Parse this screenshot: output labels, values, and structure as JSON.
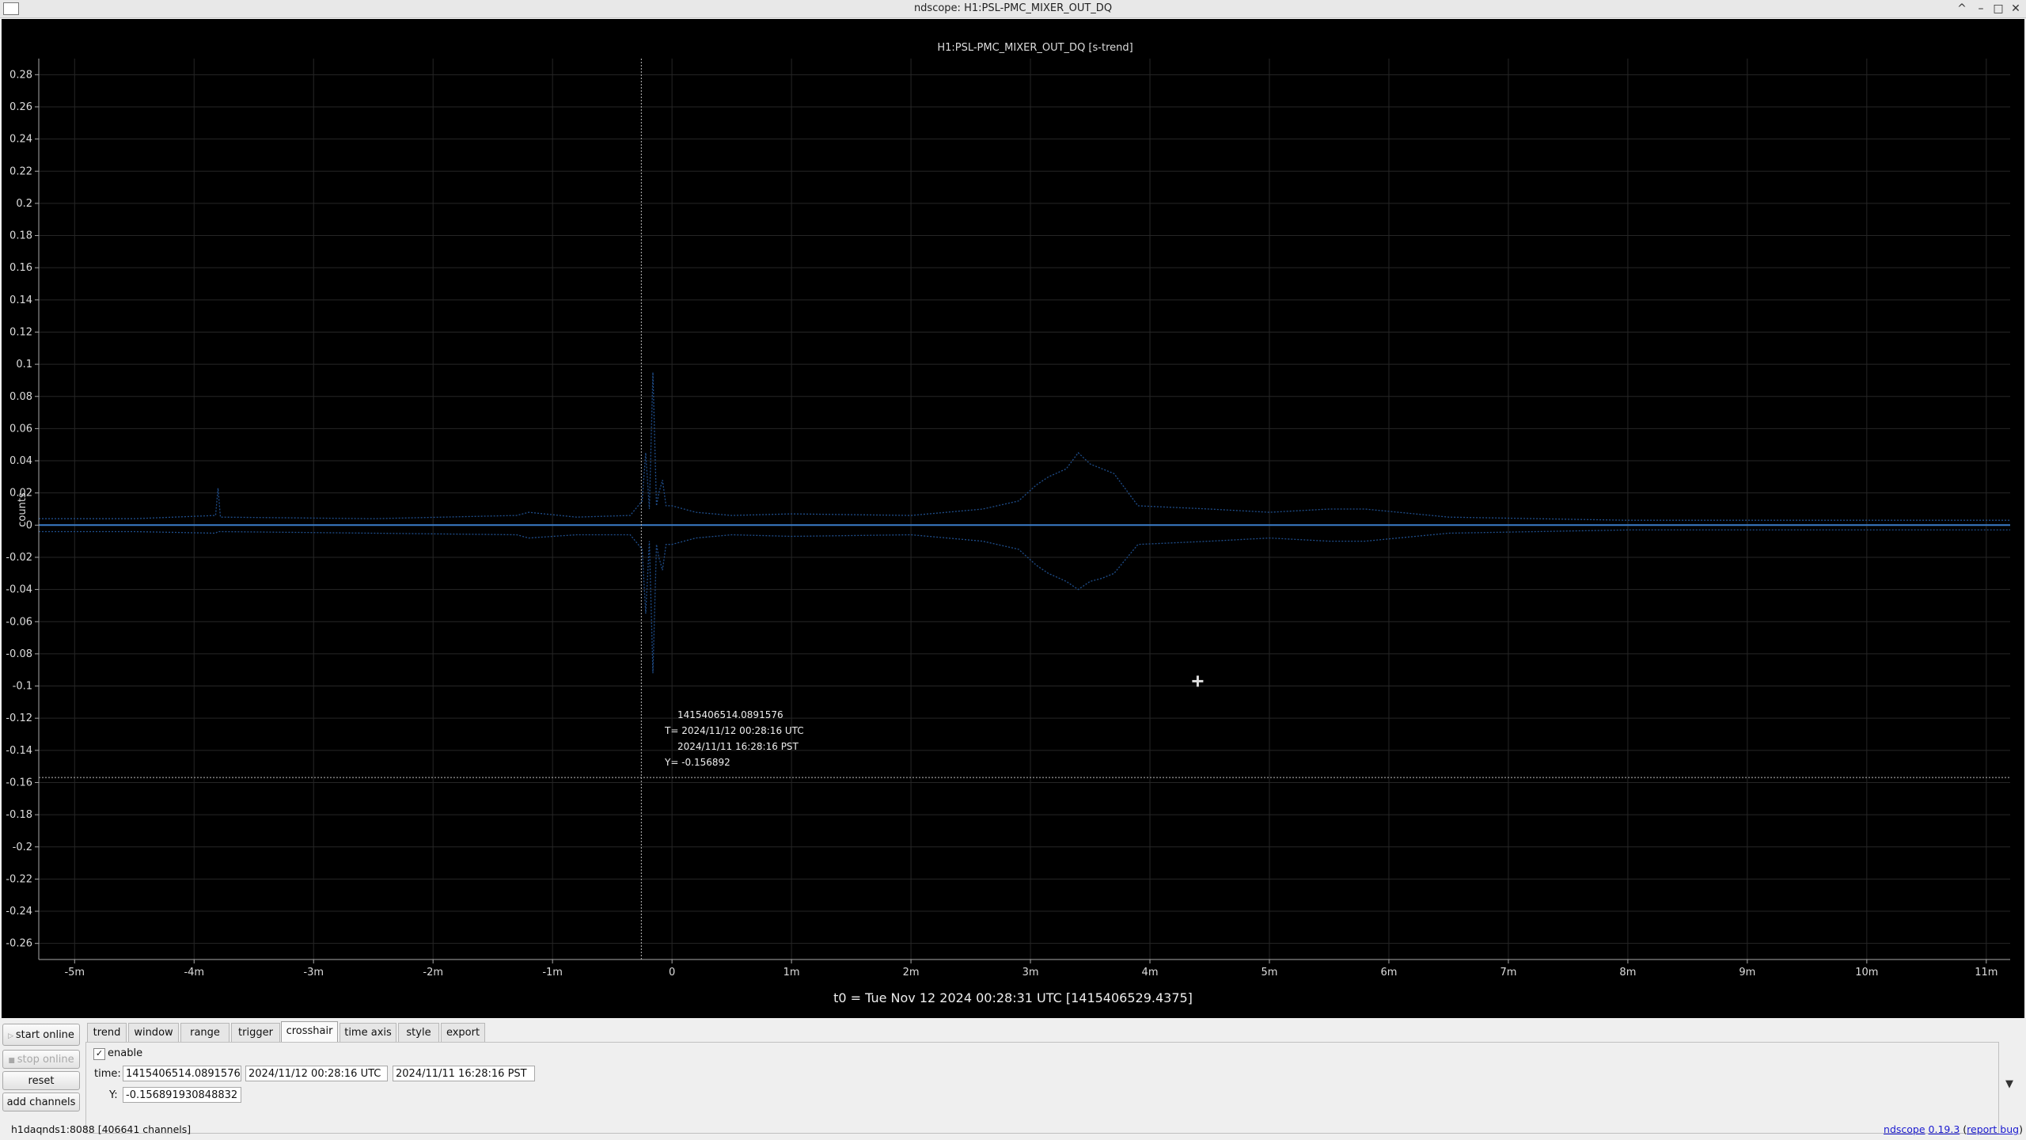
{
  "window": {
    "title": "ndscope: H1:PSL-PMC_MIXER_OUT_DQ",
    "controls": [
      "^",
      "–",
      "□",
      "✕"
    ]
  },
  "plot": {
    "title": "H1:PSL-PMC_MIXER_OUT_DQ [s-trend]",
    "t0_label": "t0 = Tue Nov 12 2024 00:28:31 UTC [1415406529.4375]",
    "crosshair": {
      "gps": "1415406514.0891576",
      "utc": "T= 2024/11/12 00:28:16 UTC",
      "pst": "2024/11/11 16:28:16 PST",
      "y": "Y= -0.156892",
      "x_value": -0.2569,
      "y_value": -0.156892
    },
    "cursor_marker": {
      "x_value": 4.4,
      "y_value": -0.097
    }
  },
  "chart_data": {
    "type": "line",
    "title": "H1:PSL-PMC_MIXER_OUT_DQ [s-trend]",
    "xlabel": "",
    "ylabel": "counts",
    "xlim": [
      -5.3,
      11.2
    ],
    "ylim": [
      -0.27,
      0.29
    ],
    "grid": true,
    "x_ticks": [
      {
        "v": -5,
        "label": "-5m"
      },
      {
        "v": -4,
        "label": "-4m"
      },
      {
        "v": -3,
        "label": "-3m"
      },
      {
        "v": -2,
        "label": "-2m"
      },
      {
        "v": -1,
        "label": "-1m"
      },
      {
        "v": 0,
        "label": "0"
      },
      {
        "v": 1,
        "label": "1m"
      },
      {
        "v": 2,
        "label": "2m"
      },
      {
        "v": 3,
        "label": "3m"
      },
      {
        "v": 4,
        "label": "4m"
      },
      {
        "v": 5,
        "label": "5m"
      },
      {
        "v": 6,
        "label": "6m"
      },
      {
        "v": 7,
        "label": "7m"
      },
      {
        "v": 8,
        "label": "8m"
      },
      {
        "v": 9,
        "label": "9m"
      },
      {
        "v": 10,
        "label": "10m"
      },
      {
        "v": 11,
        "label": "11m"
      }
    ],
    "y_ticks": [
      {
        "v": 0.28,
        "label": "0.28"
      },
      {
        "v": 0.26,
        "label": "0.26"
      },
      {
        "v": 0.24,
        "label": "0.24"
      },
      {
        "v": 0.22,
        "label": "0.22"
      },
      {
        "v": 0.2,
        "label": "0.2"
      },
      {
        "v": 0.18,
        "label": "0.18"
      },
      {
        "v": 0.16,
        "label": "0.16"
      },
      {
        "v": 0.14,
        "label": "0.14"
      },
      {
        "v": 0.12,
        "label": "0.12"
      },
      {
        "v": 0.1,
        "label": "0.1"
      },
      {
        "v": 0.08,
        "label": "0.08"
      },
      {
        "v": 0.06,
        "label": "0.06"
      },
      {
        "v": 0.04,
        "label": "0.04"
      },
      {
        "v": 0.02,
        "label": "0.02"
      },
      {
        "v": 0,
        "label": "0"
      },
      {
        "v": -0.02,
        "label": "-0.02"
      },
      {
        "v": -0.04,
        "label": "-0.04"
      },
      {
        "v": -0.06,
        "label": "-0.06"
      },
      {
        "v": -0.08,
        "label": "-0.08"
      },
      {
        "v": -0.1,
        "label": "-0.1"
      },
      {
        "v": -0.12,
        "label": "-0.12"
      },
      {
        "v": -0.14,
        "label": "-0.14"
      },
      {
        "v": -0.16,
        "label": "-0.16"
      },
      {
        "v": -0.18,
        "label": "-0.18"
      },
      {
        "v": -0.2,
        "label": "-0.2"
      },
      {
        "v": -0.22,
        "label": "-0.22"
      },
      {
        "v": -0.24,
        "label": "-0.24"
      },
      {
        "v": -0.26,
        "label": "-0.26"
      }
    ],
    "series": [
      {
        "role": "max",
        "style": "dotted",
        "color": "#1f4e8c",
        "x": [
          -5.3,
          -4.5,
          -3.82,
          -3.8,
          -3.78,
          -2.5,
          -1.3,
          -1.2,
          -0.8,
          -0.35,
          -0.25,
          -0.22,
          -0.19,
          -0.16,
          -0.13,
          -0.11,
          -0.08,
          -0.05,
          0.0,
          0.1,
          0.2,
          0.5,
          1.0,
          2.0,
          2.6,
          2.9,
          3.05,
          3.15,
          3.3,
          3.4,
          3.5,
          3.6,
          3.7,
          3.9,
          4.5,
          5.0,
          5.5,
          5.8,
          6.5,
          8.0,
          11.2
        ],
        "y": [
          0.004,
          0.004,
          0.006,
          0.023,
          0.005,
          0.004,
          0.006,
          0.008,
          0.005,
          0.006,
          0.015,
          0.045,
          0.01,
          0.095,
          0.012,
          0.02,
          0.028,
          0.012,
          0.012,
          0.01,
          0.008,
          0.006,
          0.007,
          0.006,
          0.01,
          0.015,
          0.025,
          0.03,
          0.035,
          0.045,
          0.038,
          0.035,
          0.032,
          0.012,
          0.01,
          0.008,
          0.01,
          0.01,
          0.005,
          0.003,
          0.003
        ]
      },
      {
        "role": "min",
        "style": "dotted",
        "color": "#1f4e8c",
        "x": [
          -5.3,
          -4.5,
          -3.82,
          -3.8,
          -3.78,
          -2.5,
          -1.3,
          -1.2,
          -0.8,
          -0.35,
          -0.25,
          -0.22,
          -0.19,
          -0.16,
          -0.13,
          -0.11,
          -0.08,
          -0.05,
          0.0,
          0.1,
          0.2,
          0.5,
          1.0,
          2.0,
          2.6,
          2.9,
          3.05,
          3.15,
          3.3,
          3.4,
          3.5,
          3.6,
          3.7,
          3.9,
          4.5,
          5.0,
          5.5,
          5.8,
          6.5,
          8.0,
          11.2
        ],
        "y": [
          -0.004,
          -0.004,
          -0.005,
          -0.004,
          -0.004,
          -0.005,
          -0.006,
          -0.008,
          -0.006,
          -0.006,
          -0.015,
          -0.055,
          -0.01,
          -0.092,
          -0.012,
          -0.02,
          -0.028,
          -0.012,
          -0.012,
          -0.01,
          -0.008,
          -0.006,
          -0.007,
          -0.006,
          -0.01,
          -0.015,
          -0.025,
          -0.03,
          -0.035,
          -0.04,
          -0.035,
          -0.033,
          -0.03,
          -0.012,
          -0.01,
          -0.008,
          -0.01,
          -0.01,
          -0.005,
          -0.003,
          -0.003
        ]
      },
      {
        "role": "mean",
        "style": "solid",
        "color": "#3a7cc8",
        "x": [
          -5.3,
          11.2
        ],
        "y": [
          0.0,
          0.0
        ]
      }
    ]
  },
  "sidebar": {
    "start_online": "start online",
    "stop_online": "stop online",
    "reset": "reset",
    "add_channels": "add channels"
  },
  "tabs": [
    "trend",
    "window",
    "range",
    "trigger",
    "crosshair",
    "time axis",
    "style",
    "export"
  ],
  "active_tab": "crosshair",
  "crosshair_panel": {
    "enable_label": "enable",
    "enabled": true,
    "time_label": "time:",
    "time_gps": "1415406514.0891576",
    "time_utc": "2024/11/12 00:28:16 UTC",
    "time_pst": "2024/11/11 16:28:16 PST",
    "y_label": "Y:",
    "y_value": "-0.156891930848832"
  },
  "status": {
    "server": "h1daqnds1:8088  [406641 channels]",
    "ndscope_link": "ndscope",
    "version_link": "0.19.3",
    "report_bug_link": "report bug"
  }
}
